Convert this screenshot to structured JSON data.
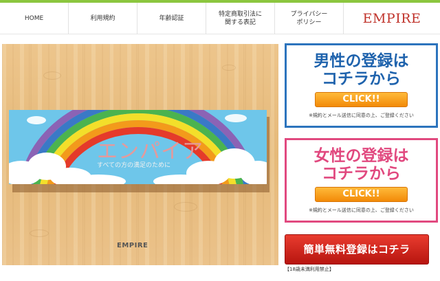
{
  "nav": {
    "items": [
      "HOME",
      "利用規約",
      "年齢認証",
      "特定商取引法に\n関する表記",
      "プライバシー\nポリシー"
    ],
    "logo": "EMPIRE"
  },
  "hero": {
    "banner_title": "エンパイア",
    "banner_subtitle": "すべての方の満足のために",
    "caption": "EMPIRE"
  },
  "male_card": {
    "heading": "男性の登録は\nコチラから",
    "button": "CLICK!!",
    "note": "※規約とメール送信に同意の上、ご登録ください"
  },
  "female_card": {
    "heading": "女性の登録は\nコチラから",
    "button": "CLICK!!",
    "note": "※規約とメール送信に同意の上、ご登録ください"
  },
  "free_register": {
    "button": "簡単無料登録はコチラ",
    "age_note": "【18歳未満利用禁止】"
  },
  "colors": {
    "accent_green": "#8cc63f",
    "male_blue": "#2c74bd",
    "female_pink": "#e1497f",
    "click_orange": "#f28a08",
    "register_red": "#c8201a",
    "logo_red": "#c0332b"
  }
}
